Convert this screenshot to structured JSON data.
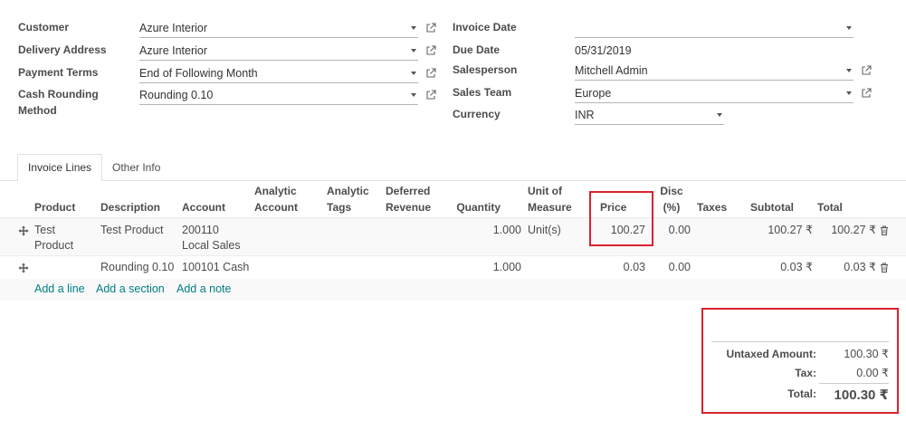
{
  "form": {
    "customer": {
      "label": "Customer",
      "value": "Azure Interior"
    },
    "delivery_address": {
      "label": "Delivery Address",
      "value": "Azure Interior"
    },
    "payment_terms": {
      "label": "Payment Terms",
      "value": "End of Following Month"
    },
    "cash_rounding": {
      "label_line1": "Cash Rounding",
      "label_line2": "Method",
      "value": "Rounding 0.10"
    },
    "invoice_date": {
      "label": "Invoice Date",
      "value": ""
    },
    "due_date": {
      "label": "Due Date",
      "value": "05/31/2019"
    },
    "salesperson": {
      "label": "Salesperson",
      "value": "Mitchell Admin"
    },
    "sales_team": {
      "label": "Sales Team",
      "value": "Europe"
    },
    "currency": {
      "label": "Currency",
      "value": "INR"
    }
  },
  "tabs": [
    {
      "label": "Invoice Lines",
      "active": true
    },
    {
      "label": "Other Info",
      "active": false
    }
  ],
  "table": {
    "headers": {
      "product": "Product",
      "description": "Description",
      "account": "Account",
      "analytic_account_1": "Analytic",
      "analytic_account_2": "Account",
      "analytic_tags_1": "Analytic",
      "analytic_tags_2": "Tags",
      "deferred_revenue_1": "Deferred",
      "deferred_revenue_2": "Revenue",
      "quantity": "Quantity",
      "uom_1": "Unit of",
      "uom_2": "Measure",
      "price": "Price",
      "disc_1": "Disc",
      "disc_2": "(%)",
      "taxes": "Taxes",
      "subtotal": "Subtotal",
      "total": "Total"
    },
    "rows": [
      {
        "product_1": "Test",
        "product_2": "Product",
        "description": "Test Product",
        "account_1": "200110",
        "account_2": "Local Sales",
        "quantity": "1.000",
        "uom": "Unit(s)",
        "price": "100.27",
        "disc": "0.00",
        "subtotal": "100.27 ₹",
        "total": "100.27 ₹"
      },
      {
        "product_1": "",
        "description": "Rounding 0.10",
        "account_1": "100101 Cash",
        "quantity": "1.000",
        "uom": "",
        "price": "0.03",
        "disc": "0.00",
        "subtotal": "0.03 ₹",
        "total": "0.03 ₹"
      }
    ],
    "actions": {
      "add_line": "Add a line",
      "add_section": "Add a section",
      "add_note": "Add a note"
    }
  },
  "totals": {
    "untaxed_label": "Untaxed Amount:",
    "untaxed_value": "100.30 ₹",
    "tax_label": "Tax:",
    "tax_value": "0.00 ₹",
    "total_label": "Total:",
    "total_value": "100.30 ₹"
  },
  "icons": {
    "dropdown": "caret-down-icon",
    "external": "external-link-icon",
    "drag": "drag-handle-icon",
    "delete": "trash-icon"
  },
  "colors": {
    "highlight_box": "#d9232d",
    "link": "#017e84",
    "row_alt": "#f9f9f9"
  }
}
